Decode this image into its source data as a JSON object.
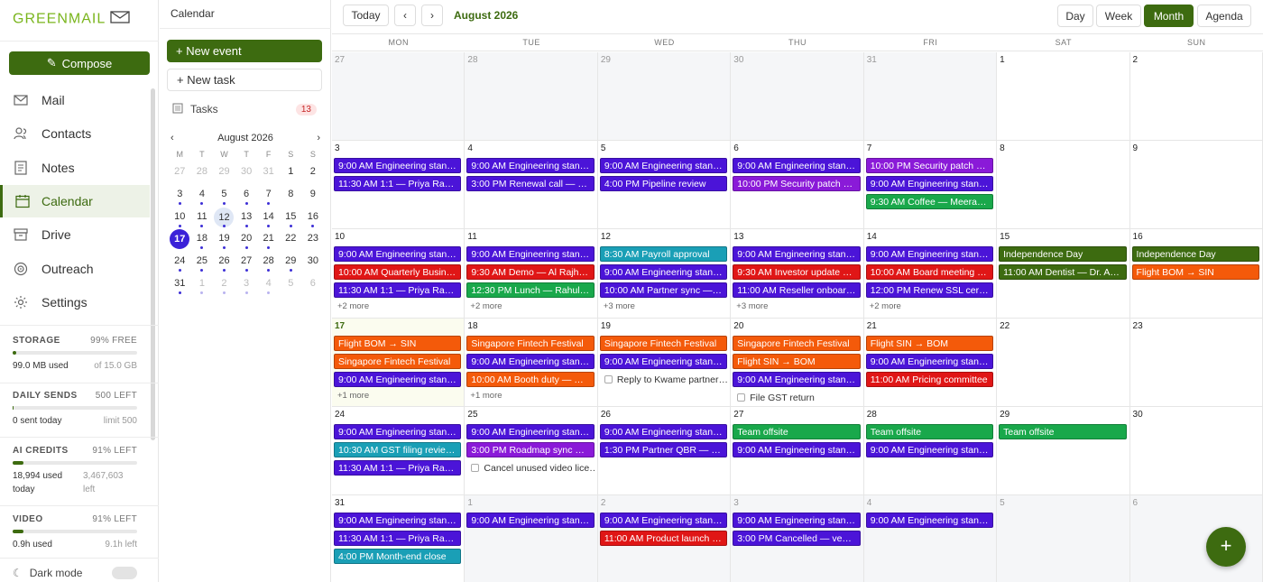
{
  "app": {
    "logo_text": "GREENMAIL"
  },
  "colors": {
    "brand": "#3d6b10",
    "accent_today": "#3b22d8",
    "purple": "#4b14d8",
    "violet": "#8a1ad8",
    "red": "#e01616",
    "green": "#19a84b",
    "teal": "#1a9fb6",
    "orange": "#f45a0a",
    "darkgreen": "#3d6b10"
  },
  "nav": {
    "compose_label": "Compose",
    "items": [
      {
        "label": "Mail",
        "icon": "mail-icon"
      },
      {
        "label": "Contacts",
        "icon": "contacts-icon"
      },
      {
        "label": "Notes",
        "icon": "notes-icon"
      },
      {
        "label": "Calendar",
        "icon": "calendar-icon",
        "active": true
      },
      {
        "label": "Drive",
        "icon": "drive-icon"
      },
      {
        "label": "Outreach",
        "icon": "outreach-icon"
      },
      {
        "label": "Settings",
        "icon": "gear-icon"
      }
    ],
    "storage": {
      "label": "STORAGE",
      "right": "99% FREE",
      "used": "99.0 MB used",
      "total": "of 15.0 GB",
      "fill": 0.01
    },
    "sends": {
      "label": "DAILY SENDS",
      "right": "500 LEFT",
      "used": "0 sent today",
      "total": "limit 500",
      "fill": 0
    },
    "ai": {
      "label": "AI CREDITS",
      "right": "91% LEFT",
      "used": "18,994 used today",
      "total": "3,467,603 left",
      "fill": 0.09
    },
    "video": {
      "label": "VIDEO",
      "right": "91% LEFT",
      "used": "0.9h used",
      "total": "9.1h left",
      "fill": 0.09
    },
    "dark_mode_label": "Dark mode"
  },
  "side": {
    "title": "Calendar",
    "new_event": "+ New event",
    "new_task": "+ New task",
    "tasks_label": "Tasks",
    "tasks_count": "13",
    "mini": {
      "month": "August 2026",
      "prev": "‹",
      "next": "›",
      "dows": [
        "M",
        "T",
        "W",
        "T",
        "F",
        "S",
        "S"
      ],
      "days": [
        {
          "n": "27",
          "o": true
        },
        {
          "n": "28",
          "o": true
        },
        {
          "n": "29",
          "o": true
        },
        {
          "n": "30",
          "o": true
        },
        {
          "n": "31",
          "o": true
        },
        {
          "n": "1"
        },
        {
          "n": "2"
        },
        {
          "n": "3",
          "dot": true
        },
        {
          "n": "4",
          "dot": true
        },
        {
          "n": "5",
          "dot": true
        },
        {
          "n": "6",
          "dot": true
        },
        {
          "n": "7",
          "dot": true
        },
        {
          "n": "8"
        },
        {
          "n": "9"
        },
        {
          "n": "10",
          "dot": true
        },
        {
          "n": "11",
          "dot": true
        },
        {
          "n": "12",
          "dot": true,
          "sel": true
        },
        {
          "n": "13",
          "dot": true
        },
        {
          "n": "14",
          "dot": true
        },
        {
          "n": "15",
          "dot": true
        },
        {
          "n": "16",
          "dot": true
        },
        {
          "n": "17",
          "dot": true,
          "today": true
        },
        {
          "n": "18",
          "dot": true
        },
        {
          "n": "19",
          "dot": true
        },
        {
          "n": "20",
          "dot": true
        },
        {
          "n": "21",
          "dot": true
        },
        {
          "n": "22"
        },
        {
          "n": "23"
        },
        {
          "n": "24",
          "dot": true
        },
        {
          "n": "25",
          "dot": true
        },
        {
          "n": "26",
          "dot": true
        },
        {
          "n": "27",
          "dot": true
        },
        {
          "n": "28",
          "dot": true
        },
        {
          "n": "29",
          "dot": true
        },
        {
          "n": "30"
        },
        {
          "n": "31",
          "dot": true
        },
        {
          "n": "1",
          "o": true,
          "dot": true
        },
        {
          "n": "2",
          "o": true,
          "dot": true
        },
        {
          "n": "3",
          "o": true,
          "dot": true
        },
        {
          "n": "4",
          "o": true,
          "dot": true
        },
        {
          "n": "5",
          "o": true
        },
        {
          "n": "6",
          "o": true
        }
      ]
    }
  },
  "toolbar": {
    "today": "Today",
    "prev": "‹",
    "next": "›",
    "month_label": "August 2026",
    "views": [
      {
        "label": "Day"
      },
      {
        "label": "Week"
      },
      {
        "label": "Month",
        "active": true
      },
      {
        "label": "Agenda"
      }
    ]
  },
  "dows": [
    "MON",
    "TUE",
    "WED",
    "THU",
    "FRI",
    "SAT",
    "SUN"
  ],
  "weeks": [
    [
      {
        "d": "27",
        "out": true,
        "items": []
      },
      {
        "d": "28",
        "out": true,
        "items": []
      },
      {
        "d": "29",
        "out": true,
        "items": []
      },
      {
        "d": "30",
        "out": true,
        "items": []
      },
      {
        "d": "31",
        "out": true,
        "items": []
      },
      {
        "d": "1",
        "items": []
      },
      {
        "d": "2",
        "items": []
      }
    ],
    [
      {
        "d": "3",
        "items": [
          {
            "t": "9:00 AM Engineering stand…",
            "c": "purple"
          },
          {
            "t": "11:30 AM 1:1 — Priya Ragh…",
            "c": "purple"
          }
        ]
      },
      {
        "d": "4",
        "items": [
          {
            "t": "9:00 AM Engineering stand…",
            "c": "purple"
          },
          {
            "t": "3:00 PM Renewal call — Pi…",
            "c": "purple"
          }
        ]
      },
      {
        "d": "5",
        "items": [
          {
            "t": "9:00 AM Engineering stand…",
            "c": "purple"
          },
          {
            "t": "4:00 PM Pipeline review",
            "c": "purple"
          }
        ]
      },
      {
        "d": "6",
        "items": [
          {
            "t": "9:00 AM Engineering stand…",
            "c": "purple"
          },
          {
            "t": "10:00 PM Security patch wi…",
            "c": "violet"
          }
        ]
      },
      {
        "d": "7",
        "items": [
          {
            "t": "10:00 PM Security patch wi…",
            "c": "violet"
          },
          {
            "t": "9:00 AM Engineering stand…",
            "c": "purple"
          },
          {
            "t": "9:30 AM Coffee — Meera …",
            "c": "green"
          }
        ]
      },
      {
        "d": "8",
        "items": []
      },
      {
        "d": "9",
        "items": []
      }
    ],
    [
      {
        "d": "10",
        "items": [
          {
            "t": "9:00 AM Engineering stand…",
            "c": "purple"
          },
          {
            "t": "10:00 AM Quarterly Busine…",
            "c": "red"
          },
          {
            "t": "11:30 AM 1:1 — Priya Ragh…",
            "c": "purple"
          }
        ],
        "more": "+2 more"
      },
      {
        "d": "11",
        "items": [
          {
            "t": "9:00 AM Engineering stand…",
            "c": "purple"
          },
          {
            "t": "9:30 AM Demo — Al Rajhi …",
            "c": "red"
          },
          {
            "t": "12:30 PM Lunch — Rahul …",
            "c": "green"
          }
        ],
        "more": "+2 more"
      },
      {
        "d": "12",
        "items": [
          {
            "t": "8:30 AM Payroll approval",
            "c": "teal"
          },
          {
            "t": "9:00 AM Engineering stand…",
            "c": "purple"
          },
          {
            "t": "10:00 AM Partner sync — S…",
            "c": "purple"
          }
        ],
        "more": "+3 more"
      },
      {
        "d": "13",
        "items": [
          {
            "t": "9:00 AM Engineering stand…",
            "c": "purple"
          },
          {
            "t": "9:30 AM Investor update call",
            "c": "red"
          },
          {
            "t": "11:00 AM Reseller onboard…",
            "c": "purple"
          }
        ],
        "more": "+3 more"
      },
      {
        "d": "14",
        "items": [
          {
            "t": "9:00 AM Engineering stand…",
            "c": "purple"
          },
          {
            "t": "10:00 AM Board meeting …",
            "c": "red"
          },
          {
            "t": "12:00 PM Renew SSL certi…",
            "c": "purple"
          }
        ],
        "more": "+2 more"
      },
      {
        "d": "15",
        "items": [
          {
            "t": "Independence Day",
            "c": "darkgreen"
          },
          {
            "t": "11:00 AM Dentist — Dr. An…",
            "c": "darkgreen"
          }
        ]
      },
      {
        "d": "16",
        "items": [
          {
            "t": "Independence Day",
            "c": "darkgreen"
          },
          {
            "t": "Flight BOM → SIN",
            "c": "orange"
          }
        ]
      }
    ],
    [
      {
        "d": "17",
        "today": true,
        "items": [
          {
            "t": "Flight BOM → SIN",
            "c": "orange"
          },
          {
            "t": "Singapore Fintech Festival",
            "c": "orange"
          },
          {
            "t": "9:00 AM Engineering stand…",
            "c": "purple"
          }
        ],
        "more": "+1 more"
      },
      {
        "d": "18",
        "items": [
          {
            "t": "Singapore Fintech Festival",
            "c": "orange"
          },
          {
            "t": "9:00 AM Engineering stand…",
            "c": "purple"
          },
          {
            "t": "10:00 AM Booth duty — H…",
            "c": "orange"
          }
        ],
        "more": "+1 more"
      },
      {
        "d": "19",
        "items": [
          {
            "t": "Singapore Fintech Festival",
            "c": "orange"
          },
          {
            "t": "9:00 AM Engineering stand…",
            "c": "purple"
          },
          {
            "task": true,
            "t": "Reply to Kwame partner…"
          }
        ]
      },
      {
        "d": "20",
        "items": [
          {
            "t": "Singapore Fintech Festival",
            "c": "orange"
          },
          {
            "t": "Flight SIN → BOM",
            "c": "orange"
          },
          {
            "t": "9:00 AM Engineering stand…",
            "c": "purple"
          },
          {
            "task": true,
            "t": "File GST return"
          }
        ]
      },
      {
        "d": "21",
        "items": [
          {
            "t": "Flight SIN → BOM",
            "c": "orange"
          },
          {
            "t": "9:00 AM Engineering stand…",
            "c": "purple"
          },
          {
            "t": "11:00 AM Pricing committee",
            "c": "red"
          }
        ]
      },
      {
        "d": "22",
        "items": []
      },
      {
        "d": "23",
        "items": []
      }
    ],
    [
      {
        "d": "24",
        "items": [
          {
            "t": "9:00 AM Engineering stand…",
            "c": "purple"
          },
          {
            "t": "10:30 AM GST filing review…",
            "c": "teal"
          },
          {
            "t": "11:30 AM 1:1 — Priya Ragh…",
            "c": "purple"
          }
        ]
      },
      {
        "d": "25",
        "items": [
          {
            "t": "9:00 AM Engineering stand…",
            "c": "purple"
          },
          {
            "t": "3:00 PM Roadmap sync — …",
            "c": "violet"
          },
          {
            "task": true,
            "t": "Cancel unused video lice…"
          }
        ]
      },
      {
        "d": "26",
        "items": [
          {
            "t": "9:00 AM Engineering stand…",
            "c": "purple"
          },
          {
            "t": "1:30 PM Partner QBR — H…",
            "c": "purple"
          }
        ]
      },
      {
        "d": "27",
        "items": [
          {
            "t": "Team offsite",
            "c": "green"
          },
          {
            "t": "9:00 AM Engineering stand…",
            "c": "purple"
          }
        ]
      },
      {
        "d": "28",
        "items": [
          {
            "t": "Team offsite",
            "c": "green"
          },
          {
            "t": "9:00 AM Engineering stand…",
            "c": "purple"
          }
        ]
      },
      {
        "d": "29",
        "items": [
          {
            "t": "Team offsite",
            "c": "green"
          }
        ]
      },
      {
        "d": "30",
        "items": []
      }
    ],
    [
      {
        "d": "31",
        "items": [
          {
            "t": "9:00 AM Engineering stand…",
            "c": "purple"
          },
          {
            "t": "11:30 AM 1:1 — Priya Ragh…",
            "c": "purple"
          },
          {
            "t": "4:00 PM Month-end close",
            "c": "teal"
          }
        ]
      },
      {
        "d": "1",
        "out": true,
        "items": [
          {
            "t": "9:00 AM Engineering stand…",
            "c": "purple"
          }
        ]
      },
      {
        "d": "2",
        "out": true,
        "items": [
          {
            "t": "9:00 AM Engineering stand…",
            "c": "purple"
          },
          {
            "t": "11:00 AM Product launch …",
            "c": "red"
          }
        ]
      },
      {
        "d": "3",
        "out": true,
        "items": [
          {
            "t": "9:00 AM Engineering stand…",
            "c": "purple"
          },
          {
            "t": "3:00 PM Cancelled — vend…",
            "c": "purple"
          }
        ]
      },
      {
        "d": "4",
        "out": true,
        "items": [
          {
            "t": "9:00 AM Engineering stand…",
            "c": "purple"
          }
        ]
      },
      {
        "d": "5",
        "out": true,
        "items": []
      },
      {
        "d": "6",
        "out": true,
        "items": []
      }
    ]
  ],
  "fab_label": "+"
}
